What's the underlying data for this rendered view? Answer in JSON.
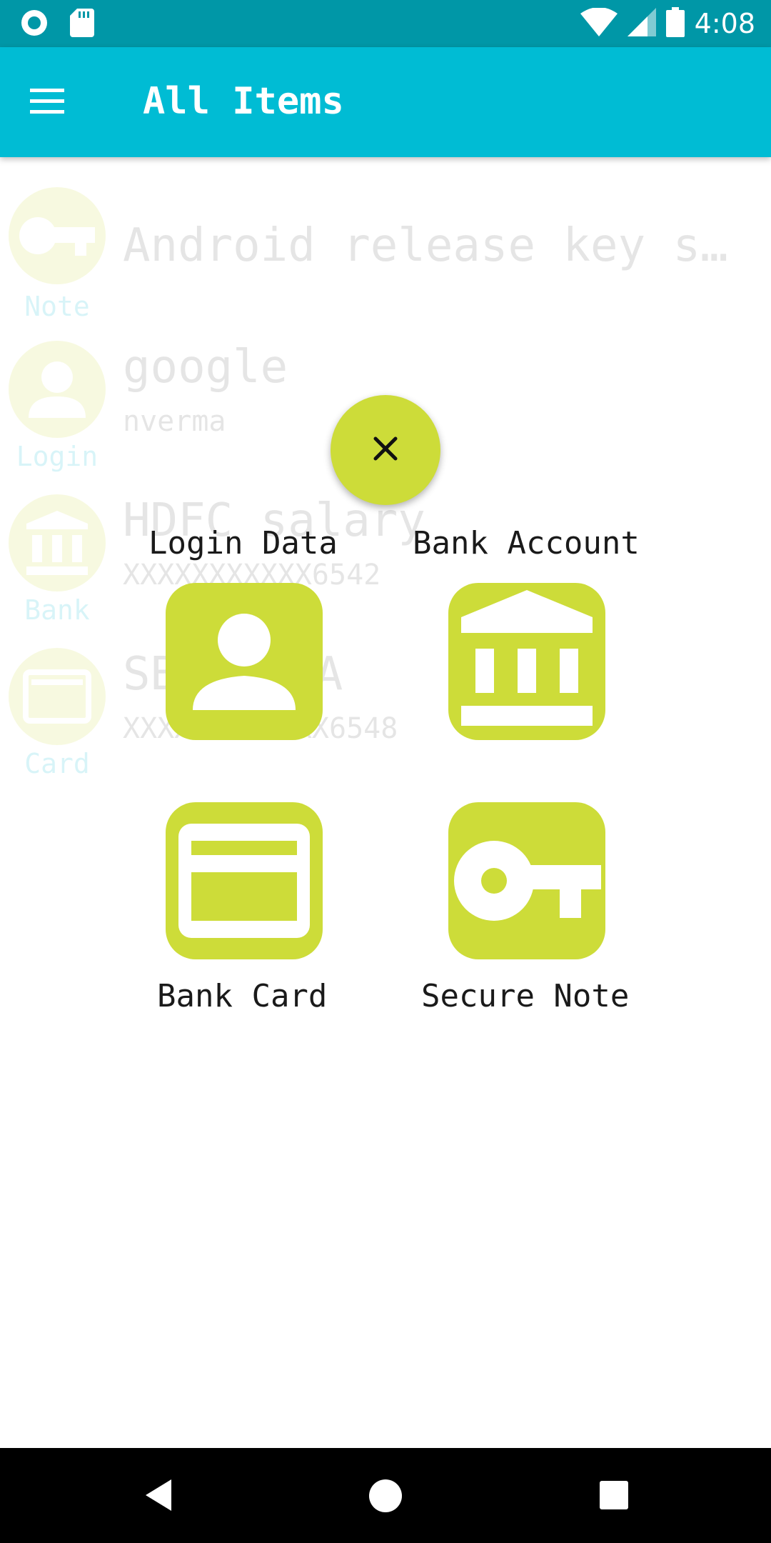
{
  "status_bar": {
    "time": "4:08",
    "icons": [
      "app-notification-icon",
      "sd-card-icon",
      "wifi-icon",
      "cell-signal-icon",
      "battery-icon"
    ]
  },
  "app_bar": {
    "title": "All Items",
    "menu_icon": "hamburger-menu-icon"
  },
  "items": [
    {
      "type": "Note",
      "title": "Android release key s…",
      "subtitle": "",
      "icon": "key-icon"
    },
    {
      "type": "Login",
      "title": "google",
      "subtitle": "nverma",
      "icon": "person-icon"
    },
    {
      "type": "Bank",
      "title": "HDFC salary",
      "subtitle": "XXXXXXXXXXX6542",
      "icon": "bank-icon"
    },
    {
      "type": "Card",
      "title": "SBI VISA",
      "subtitle": "XXXXXXXXXXXX6548",
      "icon": "card-icon"
    }
  ],
  "fab": {
    "icon": "close-icon"
  },
  "add_options": [
    {
      "label": "Login Data",
      "icon": "person-icon"
    },
    {
      "label": "Bank Account",
      "icon": "bank-icon"
    },
    {
      "label": "Bank Card",
      "icon": "card-icon"
    },
    {
      "label": "Secure Note",
      "icon": "key-icon"
    }
  ],
  "colors": {
    "status_bar": "#0097a7",
    "app_bar": "#00bcd4",
    "accent": "#cddc39",
    "nav_bar": "#000000"
  },
  "nav_bar": {
    "icons": [
      "back-icon",
      "home-icon",
      "recents-icon"
    ]
  }
}
